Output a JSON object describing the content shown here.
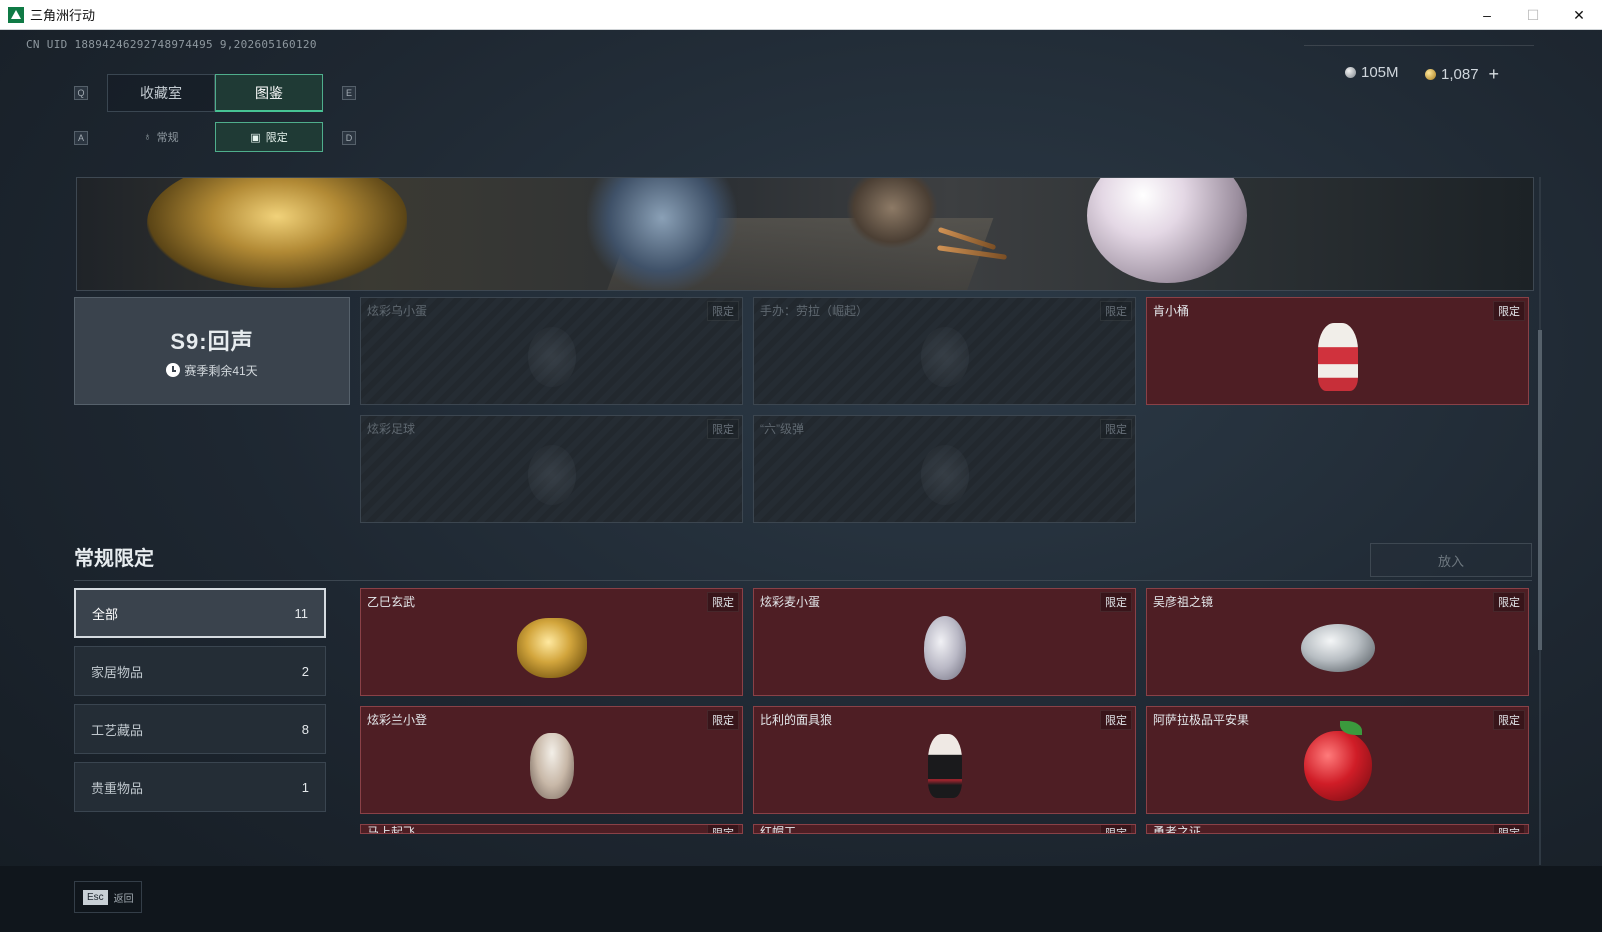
{
  "window": {
    "title": "三角洲行动",
    "minimize": "–",
    "maximize": "☐",
    "close": "✕"
  },
  "header": {
    "uid": "CN UID 18894246292748974495 9,202605160120",
    "currency_silver": "105M",
    "currency_gold": "1,087",
    "plus": "+"
  },
  "tabs": {
    "key_left": "Q",
    "key_right": "E",
    "items": [
      {
        "label": "收藏室"
      },
      {
        "label": "图鉴"
      }
    ]
  },
  "subtabs": {
    "key_left": "A",
    "key_right": "D",
    "items": [
      {
        "label": "常规"
      },
      {
        "label": "限定"
      }
    ]
  },
  "season": {
    "title": "S9:回声",
    "remaining": "赛季剩余41天"
  },
  "badge_label": "限定",
  "season_items": [
    {
      "name": "炫彩乌小蛋"
    },
    {
      "name": "手办：劳拉（崛起）"
    },
    {
      "name": "肯小桶"
    },
    {
      "name": "炫彩足球"
    },
    {
      "name": "“六”级弹"
    }
  ],
  "section": {
    "title": "常规限定",
    "put_button": "放入"
  },
  "categories": [
    {
      "label": "全部",
      "count": "11"
    },
    {
      "label": "家居物品",
      "count": "2"
    },
    {
      "label": "工艺藏品",
      "count": "8"
    },
    {
      "label": "贵重物品",
      "count": "1"
    }
  ],
  "regular_items": [
    {
      "name": "乙巳玄武"
    },
    {
      "name": "炫彩麦小蛋"
    },
    {
      "name": "吴彦祖之镜"
    },
    {
      "name": "炫彩兰小登"
    },
    {
      "name": "比利的面具狼"
    },
    {
      "name": "阿萨拉极品平安果"
    },
    {
      "name": "马上起飞"
    },
    {
      "name": "红帽工"
    },
    {
      "name": "勇者之证"
    }
  ],
  "footer": {
    "esc_key": "Esc",
    "esc_label": "返回"
  },
  "colors": {
    "accent": "#47c394",
    "card_owned": "#4e1e24",
    "card_border": "#8a4147"
  }
}
